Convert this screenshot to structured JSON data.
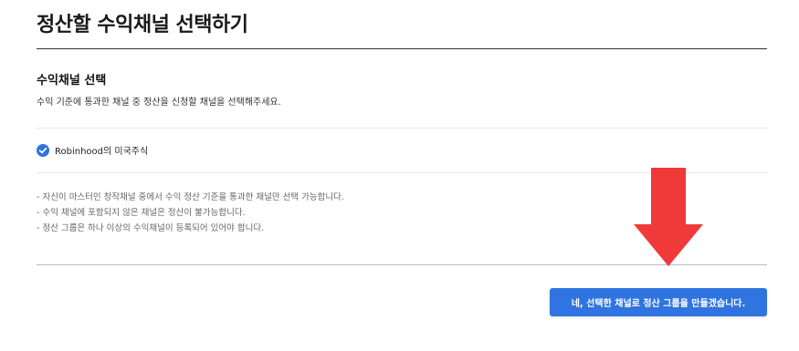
{
  "page": {
    "title": "정산할 수익채널 선택하기"
  },
  "section": {
    "title": "수익채널 선택",
    "description": "수익 기준에 통과한 채널 중 정산을 신청할 채널을 선택해주세요."
  },
  "channels": [
    {
      "label": "Robinhood의 미국주식",
      "checked": true,
      "icon": "check-circle-icon"
    }
  ],
  "notes": [
    "- 자신이 마스터인 창작채널 중에서 수익 정산 기준을 통과한 채널만 선택 가능합니다.",
    "- 수익 채널에 포함되지 않은 채널은 정산이 불가능합니다.",
    "- 정산 그룹은 하나 이상의 수익채널이 등록되어 있어야 합니다."
  ],
  "confirm_button": {
    "label": "네, 선택한 채널로 정산 그룹을 만들겠습니다."
  },
  "colors": {
    "accent": "#2f74e0",
    "annotation_arrow": "#f03a3a"
  }
}
